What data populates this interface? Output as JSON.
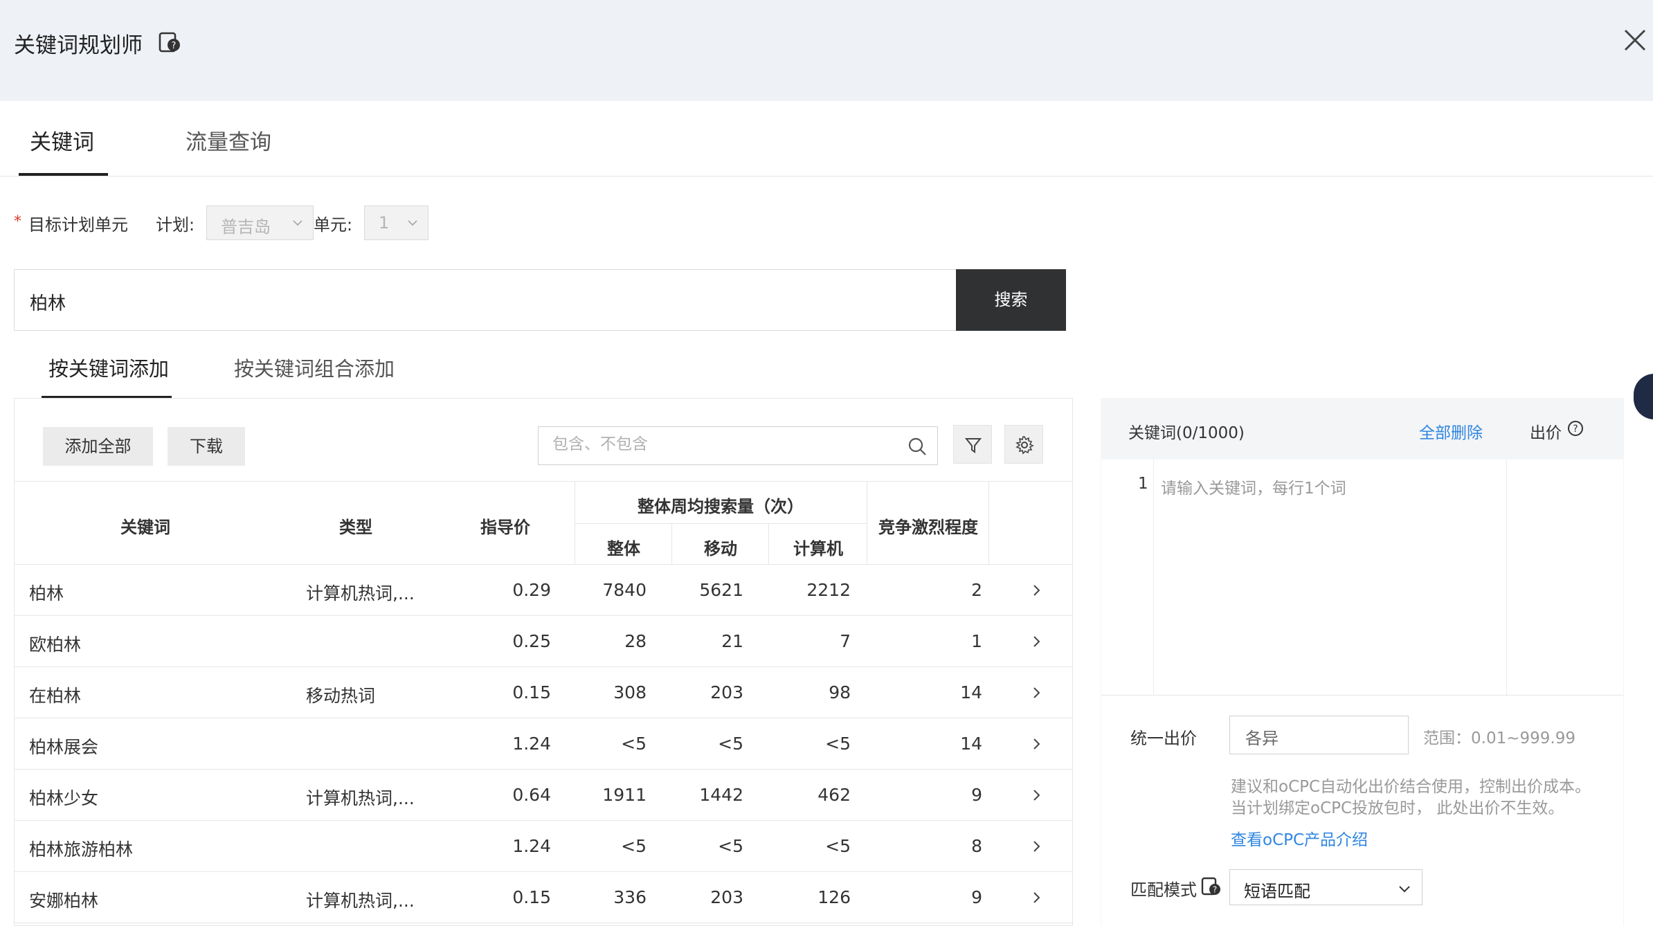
{
  "header": {
    "title": "关键词规划师"
  },
  "tabs": [
    {
      "label": "关键词"
    },
    {
      "label": "流量查询"
    }
  ],
  "target": {
    "label": "目标计划单元",
    "required_mark": "*",
    "plan_label": "计划:",
    "plan_value": "普吉岛",
    "unit_label": "单元:",
    "unit_value": "1"
  },
  "search": {
    "value": "柏林",
    "button": "搜索"
  },
  "subtabs": [
    {
      "label": "按关键词添加"
    },
    {
      "label": "按关键词组合添加"
    }
  ],
  "toolbar": {
    "add_all": "添加全部",
    "download": "下载",
    "filter_placeholder": "包含、不包含"
  },
  "table": {
    "headers": {
      "keyword": "关键词",
      "type": "类型",
      "price": "指导价",
      "weekly_group": "整体周均搜索量（次）",
      "total": "整体",
      "mobile": "移动",
      "pc": "计算机",
      "competition": "竞争激烈程度"
    },
    "rows": [
      {
        "keyword": "柏林",
        "type": "计算机热词,...",
        "price": "0.29",
        "total": "7840",
        "mobile": "5621",
        "pc": "2212",
        "competition": "2"
      },
      {
        "keyword": "欧柏林",
        "type": "",
        "price": "0.25",
        "total": "28",
        "mobile": "21",
        "pc": "7",
        "competition": "1"
      },
      {
        "keyword": "在柏林",
        "type": "移动热词",
        "price": "0.15",
        "total": "308",
        "mobile": "203",
        "pc": "98",
        "competition": "14"
      },
      {
        "keyword": "柏林展会",
        "type": "",
        "price": "1.24",
        "total": "<5",
        "mobile": "<5",
        "pc": "<5",
        "competition": "14"
      },
      {
        "keyword": "柏林少女",
        "type": "计算机热词,...",
        "price": "0.64",
        "total": "1911",
        "mobile": "1442",
        "pc": "462",
        "competition": "9"
      },
      {
        "keyword": "柏林旅游柏林",
        "type": "",
        "price": "1.24",
        "total": "<5",
        "mobile": "<5",
        "pc": "<5",
        "competition": "8"
      },
      {
        "keyword": "安娜柏林",
        "type": "计算机热词,...",
        "price": "0.15",
        "total": "336",
        "mobile": "203",
        "pc": "126",
        "competition": "9"
      }
    ]
  },
  "right_panel": {
    "keywords_label": "关键词(",
    "keywords_count": "0",
    "keywords_max": "/1000)",
    "delete_all": "全部删除",
    "bid_label": "出价",
    "line_number": "1",
    "keyword_placeholder": "请输入关键词，每行1个词",
    "unified_bid_label": "统一出价",
    "unified_bid_value": "各异",
    "range_text": "范围：0.01~999.99",
    "note_line1": "建议和oCPC自动化出价结合使用，控制出价成本。",
    "note_line2": "当计划绑定oCPC投放包时，  此处出价不生效。",
    "ocpc_link": "查看oCPC产品介绍",
    "match_label": "匹配模式",
    "match_value": "短语匹配"
  }
}
